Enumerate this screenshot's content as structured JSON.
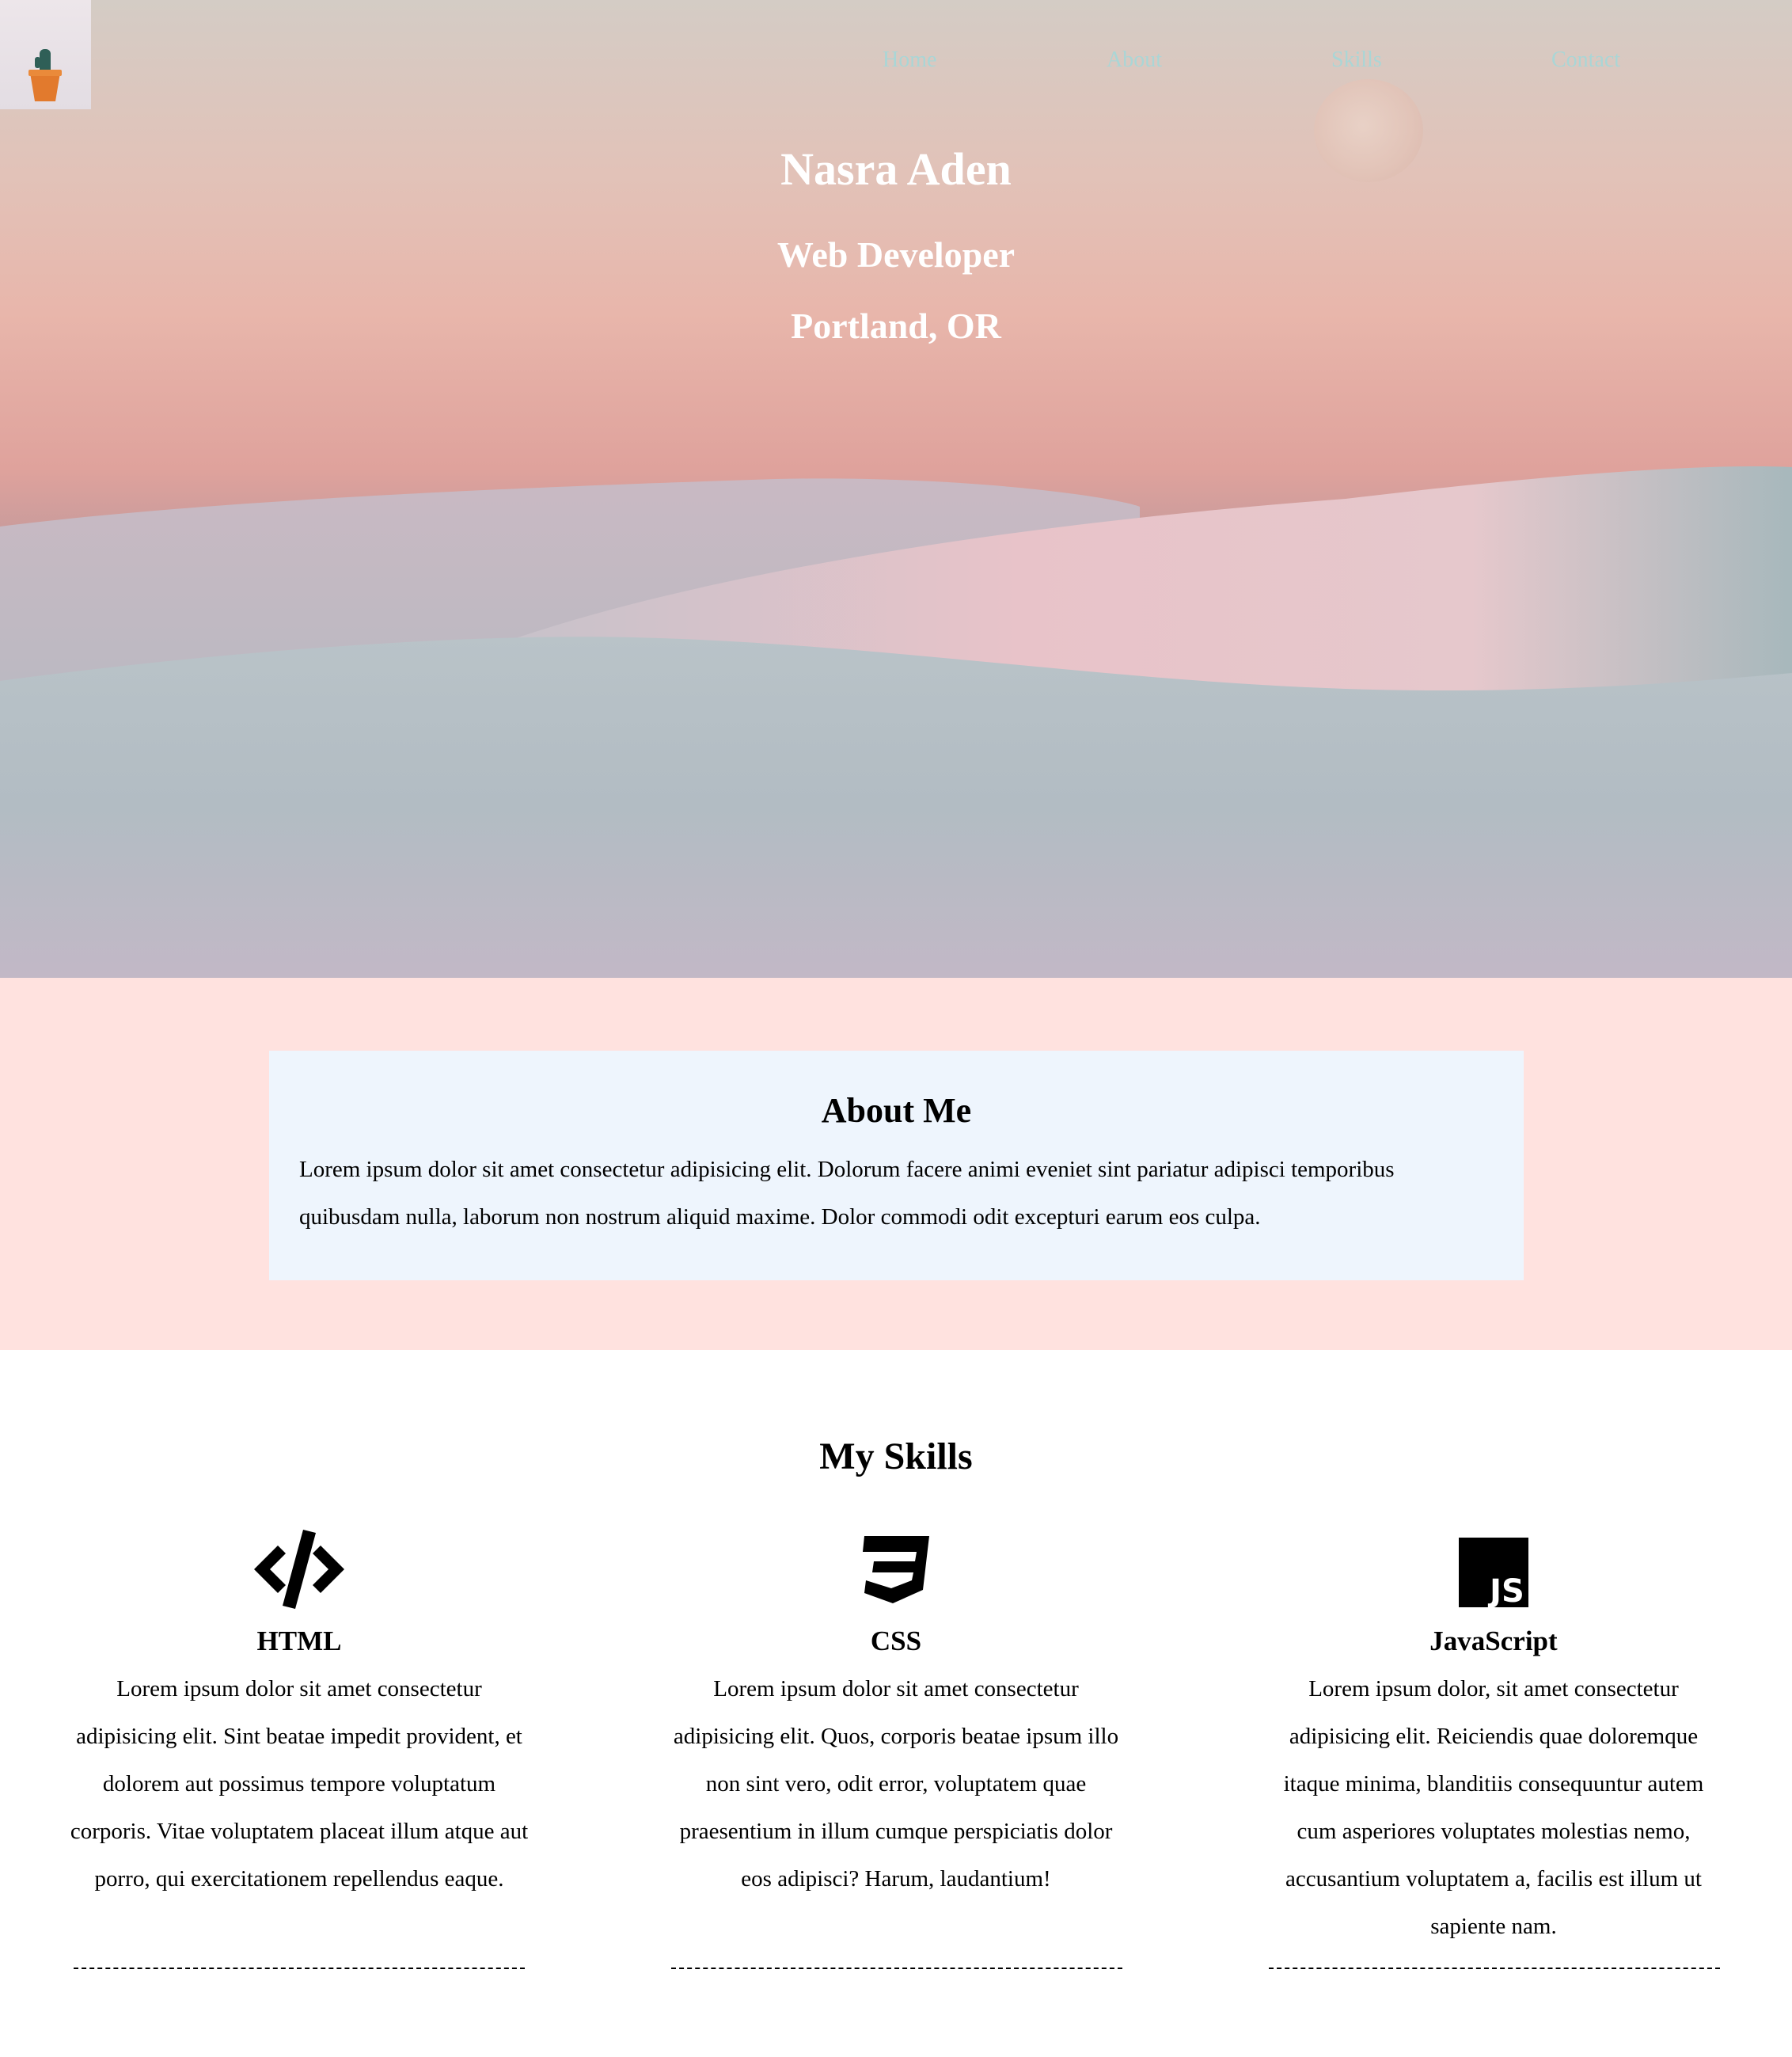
{
  "nav": {
    "items": [
      {
        "label": "Home"
      },
      {
        "label": "About"
      },
      {
        "label": "Skills"
      },
      {
        "label": "Contact"
      }
    ]
  },
  "hero": {
    "name": "Nasra Aden",
    "role": "Web Developer",
    "location": "Portland, OR"
  },
  "about": {
    "title": "About Me",
    "text": "Lorem ipsum dolor sit amet consectetur adipisicing elit. Dolorum facere animi eveniet sint pariatur adipisci temporibus quibusdam nulla, laborum non nostrum aliquid maxime. Dolor commodi odit excepturi earum eos culpa."
  },
  "skills": {
    "title": "My Skills",
    "items": [
      {
        "icon": "html-code-icon",
        "name": "HTML",
        "text": "Lorem ipsum dolor sit amet consectetur adipisicing elit. Sint beatae impedit provident, et dolorem aut possimus tempore voluptatum corporis. Vitae voluptatem placeat illum atque aut porro, qui exercitationem repellendus eaque."
      },
      {
        "icon": "css3-icon",
        "name": "CSS",
        "text": "Lorem ipsum dolor sit amet consectetur adipisicing elit. Quos, corporis beatae ipsum illo non sint vero, odit error, voluptatem quae praesentium in illum cumque perspiciatis dolor eos adipisci? Harum, laudantium!"
      },
      {
        "icon": "javascript-icon",
        "name": "JavaScript",
        "text": "Lorem ipsum dolor, sit amet consectetur adipisicing elit. Reiciendis quae doloremque itaque minima, blanditiis consequuntur autem cum asperiores voluptates molestias nemo, accusantium voluptatem a, facilis est illum ut sapiente nam."
      }
    ]
  },
  "colors": {
    "nav_link": "#a9d6d6",
    "about_section_bg": "#ffe2df",
    "about_card_bg": "#eef5fd",
    "hero_text": "#ffffff"
  }
}
